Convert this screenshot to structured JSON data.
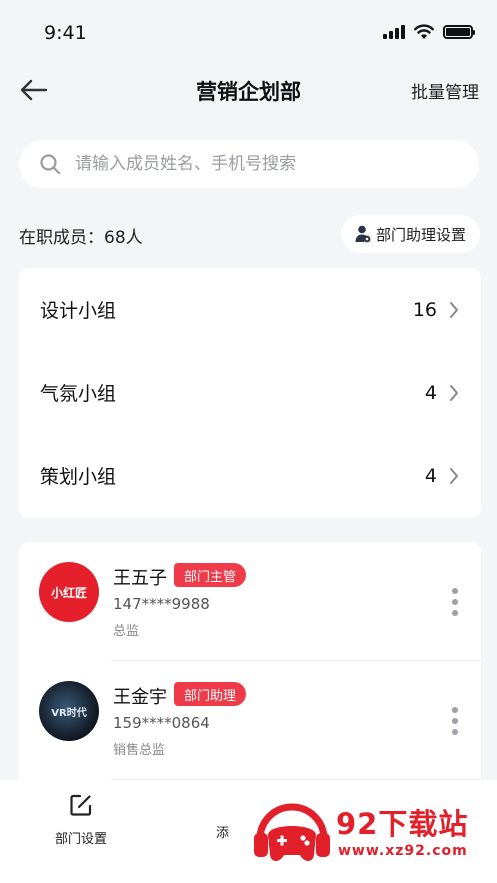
{
  "status_bar": {
    "time": "9:41"
  },
  "nav": {
    "title": "营销企划部",
    "action": "批量管理"
  },
  "search": {
    "placeholder": "请输入成员姓名、手机号搜索"
  },
  "members_summary": {
    "text": "在职成员：68人",
    "assistant_button": "部门助理设置"
  },
  "groups": [
    {
      "name": "设计小组",
      "count": "16"
    },
    {
      "name": "气氛小组",
      "count": "4"
    },
    {
      "name": "策划小组",
      "count": "4"
    }
  ],
  "members": [
    {
      "name": "王五子",
      "badge": "部门主管",
      "phone": "147****9988",
      "title": "总监",
      "avatar_text": "小红匠"
    },
    {
      "name": "王金宇",
      "badge": "部门助理",
      "phone": "159****0864",
      "title": "销售总监",
      "avatar_text": "VR时代"
    }
  ],
  "bottom_bar": {
    "dept_settings": "部门设置",
    "add_partial": "添"
  },
  "watermark": {
    "brand": "92下载站",
    "url": "www.xz92.com"
  },
  "colors": {
    "accent_red": "#ef3a4a",
    "background": "#f4f5f7"
  }
}
